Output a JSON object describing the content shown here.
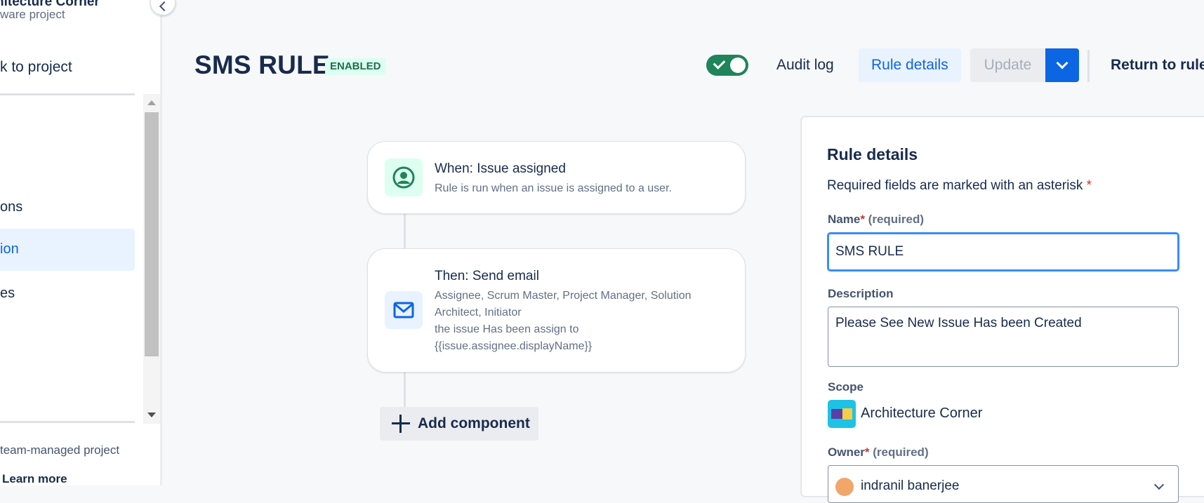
{
  "sidebar": {
    "project_name": "hitecture Corner",
    "project_type": "ware project",
    "back_link": "k to project",
    "nav_items": [
      "ons",
      "ion",
      "es"
    ],
    "promo_text": "team-managed project",
    "learn_more": "Learn more"
  },
  "header": {
    "title": "SMS RULE",
    "status": "ENABLED",
    "toggle_enabled": true,
    "audit_log": "Audit log",
    "rule_details": "Rule details",
    "update": "Update",
    "return": "Return to rule"
  },
  "flow": {
    "trigger": {
      "title": "When: Issue assigned",
      "description": "Rule is run when an issue is assigned to a user.",
      "icon": "user-circle-icon"
    },
    "action": {
      "title": "Then: Send email",
      "recipients": "Assignee, Scrum Master, Project Manager, Solution Architect, Initiator",
      "body_line1": "the issue Has been assign to",
      "body_line2": "{{issue.assignee.displayName}}",
      "icon": "email-icon"
    },
    "add_component": "Add component"
  },
  "details_panel": {
    "title": "Rule details",
    "required_note": "Required fields are marked with an asterisk",
    "asterisk": "*",
    "name_label": "Name",
    "required_hint": "(required)",
    "name_value": "SMS RULE",
    "description_label": "Description",
    "description_value": "Please See New Issue Has been Created",
    "scope_label": "Scope",
    "scope_value": "Architecture Corner",
    "owner_label": "Owner",
    "owner_value": "indranil banerjee"
  },
  "colors": {
    "primary": "#0c66e4",
    "success": "#1f845a",
    "lozenge_bg": "#dcfff1",
    "trigger_icon_bg": "#dcfff1",
    "action_icon_bg": "#e9f2ff"
  }
}
